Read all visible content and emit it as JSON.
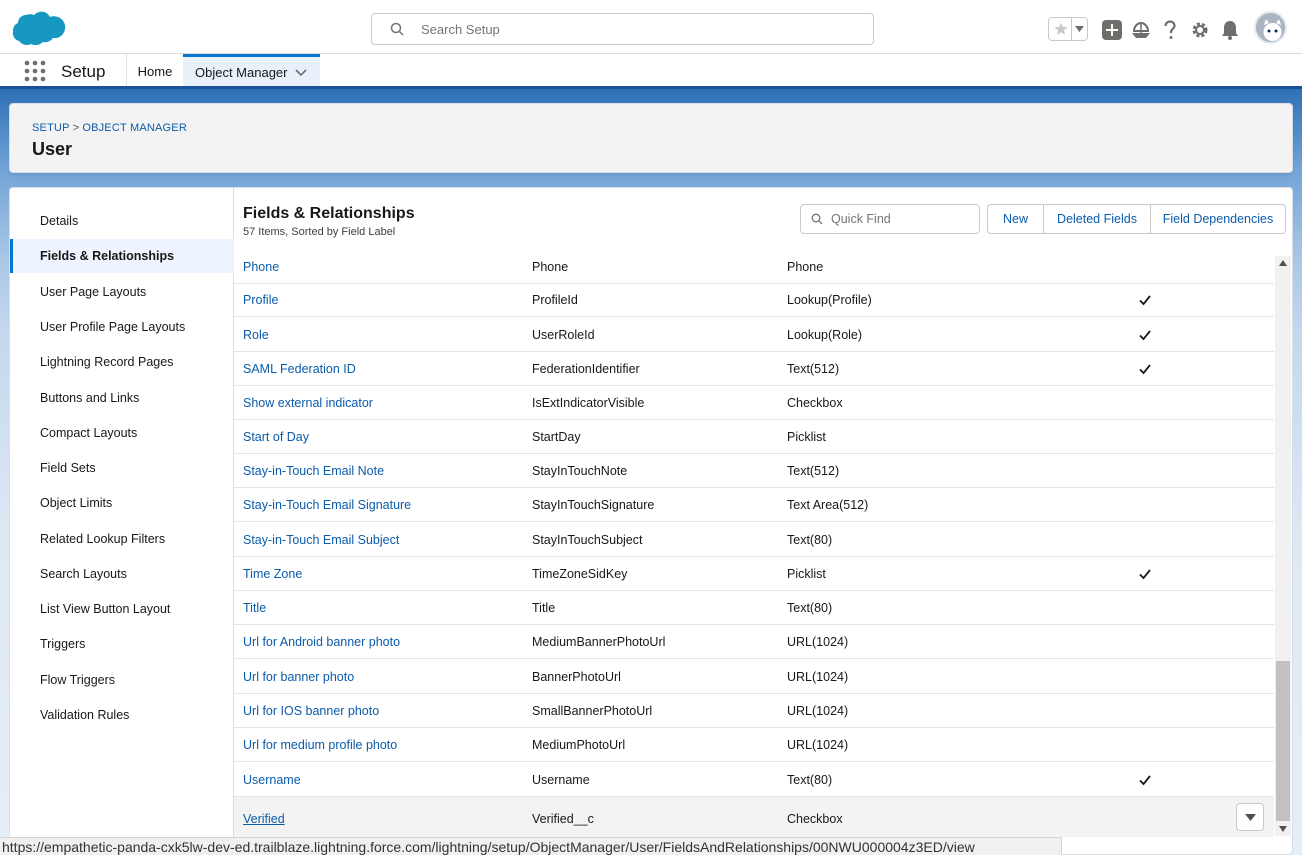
{
  "header": {
    "logo": "salesforce-cloud-logo",
    "search_placeholder": "Search Setup",
    "icons": [
      "star-icon",
      "chevron-down-icon",
      "add-icon",
      "trailhead-icon",
      "help-icon",
      "gear-icon",
      "bell-icon",
      "avatar"
    ]
  },
  "context_bar": {
    "app_name": "Setup",
    "tabs": [
      {
        "label": "Home"
      },
      {
        "label": "Object Manager",
        "active": true
      }
    ]
  },
  "page_header": {
    "breadcrumb": [
      "SETUP",
      "OBJECT MANAGER"
    ],
    "breadcrumb_sep": ">",
    "title": "User"
  },
  "sidebar": {
    "items": [
      {
        "label": "Details"
      },
      {
        "label": "Fields & Relationships",
        "active": true
      },
      {
        "label": "User Page Layouts"
      },
      {
        "label": "User Profile Page Layouts"
      },
      {
        "label": "Lightning Record Pages"
      },
      {
        "label": "Buttons and Links"
      },
      {
        "label": "Compact Layouts"
      },
      {
        "label": "Field Sets"
      },
      {
        "label": "Object Limits"
      },
      {
        "label": "Related Lookup Filters"
      },
      {
        "label": "Search Layouts"
      },
      {
        "label": "List View Button Layout"
      },
      {
        "label": "Triggers"
      },
      {
        "label": "Flow Triggers"
      },
      {
        "label": "Validation Rules"
      }
    ]
  },
  "content": {
    "title": "Fields & Relationships",
    "subtitle": "57 Items, Sorted by Field Label",
    "quick_find_placeholder": "Quick Find",
    "buttons": {
      "new": "New",
      "deleted_fields": "Deleted Fields",
      "field_dependencies": "Field Dependencies"
    },
    "rows": [
      {
        "label": "Phone",
        "api": "Phone",
        "type": "Phone",
        "indexed": false
      },
      {
        "label": "Profile",
        "api": "ProfileId",
        "type": "Lookup(Profile)",
        "indexed": true
      },
      {
        "label": "Role",
        "api": "UserRoleId",
        "type": "Lookup(Role)",
        "indexed": true
      },
      {
        "label": "SAML Federation ID",
        "api": "FederationIdentifier",
        "type": "Text(512)",
        "indexed": true
      },
      {
        "label": "Show external indicator",
        "api": "IsExtIndicatorVisible",
        "type": "Checkbox",
        "indexed": false
      },
      {
        "label": "Start of Day",
        "api": "StartDay",
        "type": "Picklist",
        "indexed": false
      },
      {
        "label": "Stay-in-Touch Email Note",
        "api": "StayInTouchNote",
        "type": "Text(512)",
        "indexed": false
      },
      {
        "label": "Stay-in-Touch Email Signature",
        "api": "StayInTouchSignature",
        "type": "Text Area(512)",
        "indexed": false
      },
      {
        "label": "Stay-in-Touch Email Subject",
        "api": "StayInTouchSubject",
        "type": "Text(80)",
        "indexed": false
      },
      {
        "label": "Time Zone",
        "api": "TimeZoneSidKey",
        "type": "Picklist",
        "indexed": true
      },
      {
        "label": "Title",
        "api": "Title",
        "type": "Text(80)",
        "indexed": false
      },
      {
        "label": "Url for Android banner photo",
        "api": "MediumBannerPhotoUrl",
        "type": "URL(1024)",
        "indexed": false
      },
      {
        "label": "Url for banner photo",
        "api": "BannerPhotoUrl",
        "type": "URL(1024)",
        "indexed": false
      },
      {
        "label": "Url for IOS banner photo",
        "api": "SmallBannerPhotoUrl",
        "type": "URL(1024)",
        "indexed": false
      },
      {
        "label": "Url for medium profile photo",
        "api": "MediumPhotoUrl",
        "type": "URL(1024)",
        "indexed": false
      },
      {
        "label": "Username",
        "api": "Username",
        "type": "Text(80)",
        "indexed": true
      },
      {
        "label": "Verified",
        "api": "Verified__c",
        "type": "Checkbox",
        "indexed": false,
        "hover": true
      }
    ]
  },
  "status_bar": {
    "url": "https://empathetic-panda-cxk5lw-dev-ed.trailblaze.lightning.force.com/lightning/setup/ObjectManager/User/FieldsAndRelationships/00NWU000004z3ED/view"
  },
  "colors": {
    "brand_blue": "#0176d3",
    "link_blue": "#0b5cab",
    "cloud_blue": "#1798c1"
  }
}
